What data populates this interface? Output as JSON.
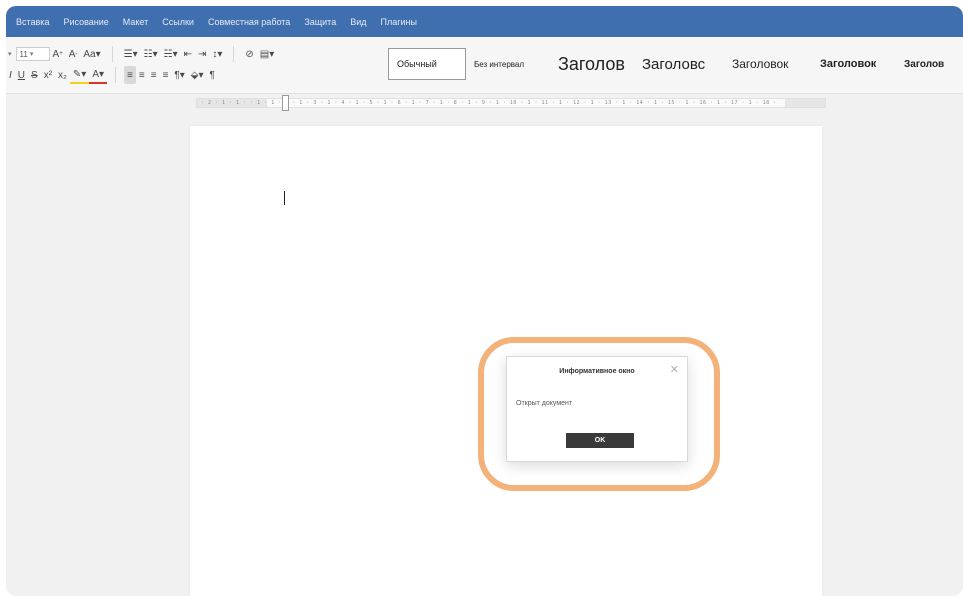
{
  "menubar": {
    "items": [
      {
        "label": "Вставка"
      },
      {
        "label": "Рисование"
      },
      {
        "label": "Макет"
      },
      {
        "label": "Ссылки"
      },
      {
        "label": "Совместная работа"
      },
      {
        "label": "Защита"
      },
      {
        "label": "Вид"
      },
      {
        "label": "Плагины"
      }
    ],
    "bg_color": "#3f6fae"
  },
  "ribbon": {
    "font_size": "11",
    "styles": [
      {
        "label": "Обычный"
      },
      {
        "label": "Без интервал"
      },
      {
        "label": "Заголов"
      },
      {
        "label": "Заголовс"
      },
      {
        "label": "Заголовок"
      },
      {
        "label": "Заголовок"
      },
      {
        "label": "Заголов"
      }
    ],
    "selected_style": "Обычный"
  },
  "ruler": {
    "text": "· 2 · 1 · 1 · · 1 · 1 · 2 · 1 · 3 · 1 · 4 · 1 · 5 · 1 · 6 · 1 · 7 · 1 · 8 · 1 · 9 · 1 · 10 · 1 · 11 · 1 · 12 · 1 · 13 · 1 · 14 · 1 · 15 · 1 · 16 · 1 · 17 · 1 · 18 ·"
  },
  "dialog": {
    "title": "Информативное окно",
    "message": "Открыт документ",
    "ok_label": "OK",
    "close_glyph": "✕"
  },
  "highlight_color": "#f2b27a"
}
